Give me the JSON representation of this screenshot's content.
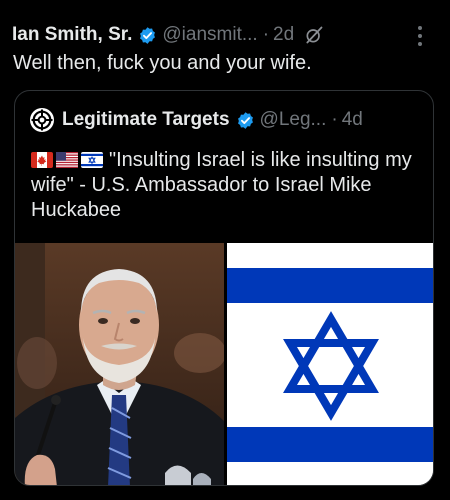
{
  "post": {
    "author_name": "Ian Smith, Sr.",
    "handle": "@iansmit...",
    "separator": "·",
    "time": "2d",
    "text": "Well then, fuck you and your wife.",
    "icons": {
      "verified": "verified-badge-icon",
      "grok": "grok-icon",
      "more": "more-options-icon"
    }
  },
  "quote": {
    "author_name": "Legitimate Targets",
    "handle": "@Leg...",
    "separator": "·",
    "time": "4d",
    "text": "\"Insulting Israel is like insulting my wife\" - U.S. Ambassador to Israel Mike Huckabee",
    "flags": [
      "canada-flag-icon",
      "us-flag-icon",
      "israel-flag-icon"
    ],
    "media": [
      "photo-of-mike-huckabee",
      "flag-of-israel"
    ]
  },
  "colors": {
    "background": "#000000",
    "text": "#e7e9ea",
    "secondary": "#71767b",
    "verified": "#1d9bf0",
    "border": "#2f3336",
    "israel_blue": "#0038b8"
  }
}
